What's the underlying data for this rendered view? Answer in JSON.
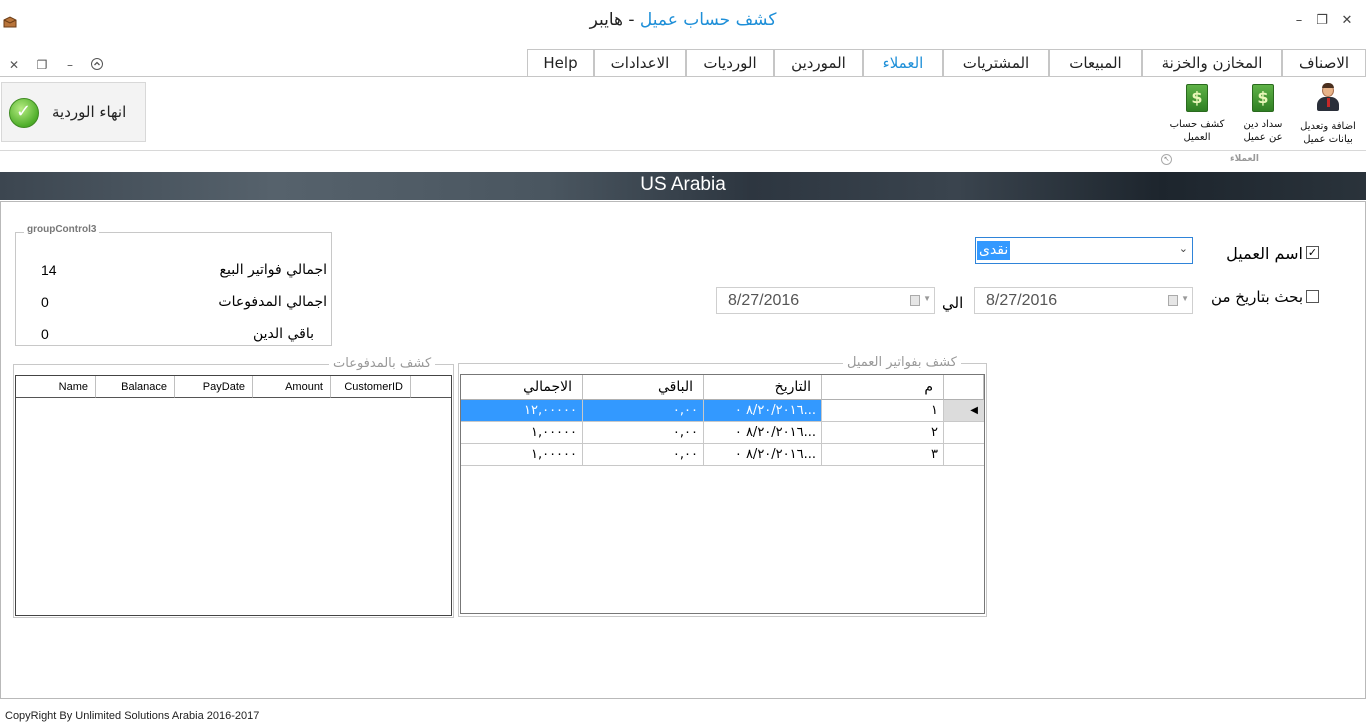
{
  "window": {
    "title_main": "كشف حساب عميل",
    "title_separator": " - ",
    "title_user": "هايبر"
  },
  "tabs": [
    {
      "label": "Help"
    },
    {
      "label": "الاعدادات"
    },
    {
      "label": "الورديات"
    },
    {
      "label": "الموردين"
    },
    {
      "label": "العملاء",
      "active": true
    },
    {
      "label": "المشتريات"
    },
    {
      "label": "المبيعات"
    },
    {
      "label": "المخازن والخزنة"
    },
    {
      "label": "الاصناف"
    }
  ],
  "ribbon": {
    "end_shift_label": "انهاء الوردية",
    "group_caption": "العملاء",
    "buttons": [
      {
        "line1": "كشف حساب",
        "line2": "العميل",
        "icon": "money-book-icon"
      },
      {
        "line1": "سداد دين",
        "line2": "عن عميل",
        "icon": "money-book-icon"
      },
      {
        "line1": "اضافة وتعديل",
        "line2": "بيانات عميل",
        "icon": "businessman-icon"
      }
    ]
  },
  "banner": {
    "text": "US Arabia"
  },
  "filters": {
    "customer_label": "اسم العميل",
    "customer_checked": true,
    "customer_value": "نقدى",
    "date_label": "بحث بتاريخ من",
    "date_checked": false,
    "date_from": "8/27/2016",
    "to_label": "الي",
    "date_to": "8/27/2016"
  },
  "summary": {
    "title": "groupControl3",
    "rows": [
      {
        "label": "اجمالي فواتير البيع",
        "value": "14"
      },
      {
        "label": "اجمالي المدفوعات",
        "value": "0"
      },
      {
        "label": "باقي الدين",
        "value": "0"
      }
    ]
  },
  "invoices": {
    "title": "كشف بفواتير العميل",
    "columns": [
      "م",
      "التاريخ",
      "الباقي",
      "الاجمالي"
    ],
    "rows": [
      {
        "num": "١",
        "date": "٨/٢٠/٢٠١٦ ٠...",
        "remaining": "٠,٠٠",
        "total": "١٢,٠٠٠٠٠",
        "selected": true
      },
      {
        "num": "٢",
        "date": "٨/٢٠/٢٠١٦ ٠...",
        "remaining": "٠,٠٠",
        "total": "١,٠٠٠٠٠",
        "selected": false
      },
      {
        "num": "٣",
        "date": "٨/٢٠/٢٠١٦ ٠...",
        "remaining": "٠,٠٠",
        "total": "١,٠٠٠٠٠",
        "selected": false
      }
    ]
  },
  "payments": {
    "title": "كشف بالمدفوعات",
    "columns": [
      "Name",
      "Balanace",
      "PayDate",
      "Amount",
      "CustomerID"
    ]
  },
  "footer": {
    "text": "CopyRight By Unlimited Solutions Arabia 2016-2017"
  }
}
